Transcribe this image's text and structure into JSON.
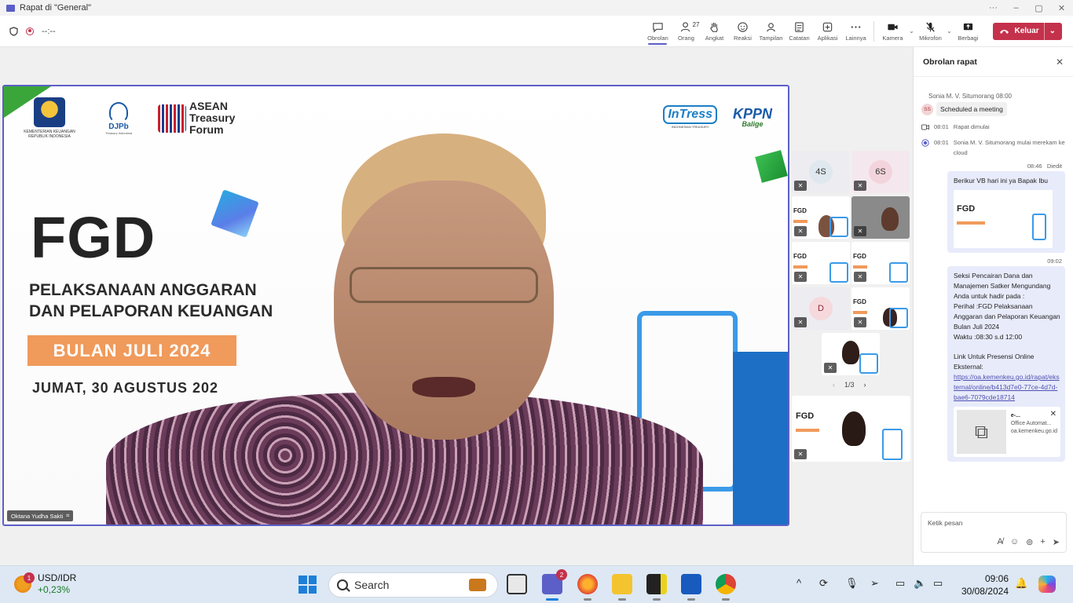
{
  "window": {
    "title": "Rapat di \"General\"",
    "min": "–",
    "max": "▢",
    "close": "✕",
    "more": "···"
  },
  "recording": {
    "timer": "--:--"
  },
  "toolbar": {
    "items": [
      {
        "label": "Obrolan",
        "icon": "chat-icon"
      },
      {
        "label": "Orang",
        "icon": "people-icon",
        "count": "27"
      },
      {
        "label": "Angkat",
        "icon": "raise-hand-icon"
      },
      {
        "label": "Reaksi",
        "icon": "reaction-icon"
      },
      {
        "label": "Tampilan",
        "icon": "view-icon"
      },
      {
        "label": "Catatan",
        "icon": "notes-icon"
      },
      {
        "label": "Aplikasi",
        "icon": "apps-icon"
      },
      {
        "label": "Lainnya",
        "icon": "more-icon"
      },
      {
        "label": "Kamera",
        "icon": "camera-icon"
      },
      {
        "label": "Mikrofon",
        "icon": "mic-off-icon"
      },
      {
        "label": "Berbagi",
        "icon": "share-icon"
      }
    ],
    "leave_label": "Keluar"
  },
  "slide": {
    "org1": "KEMENTERIAN KEUANGAN",
    "org1_sub": "REPUBLIK INDONESIA",
    "org2": "DJPb",
    "org2_sub": "Treasury Indonesia",
    "org3_line1": "ASEAN",
    "org3_line2": "Treasury",
    "org3_line3": "Forum",
    "org4": "InTress",
    "org4_sub": "INDONESIAN TREASURY",
    "org5": "KPPN",
    "org5_sub": "Balige",
    "title": "FGD",
    "subtitle_line1": "PELAKSANAAN ANGGARAN",
    "subtitle_line2": "DAN PELAPORAN KEUANGAN",
    "month_badge": "BULAN JULI 2024",
    "date": "JUMAT, 30 AGUSTUS 202"
  },
  "speaker": {
    "name": "Oktana Yudha Sakti"
  },
  "participants": {
    "tiles": [
      {
        "initials": "4S"
      },
      {
        "initials": "6S"
      },
      {
        "initials": "D"
      }
    ],
    "pager": {
      "prev": "‹",
      "label": "1/3",
      "next": "›"
    },
    "mini_title": "FGD"
  },
  "chat": {
    "title": "Obrolan rapat",
    "system": {
      "sender": "Sonia M. V. Situmorang",
      "time": "08:00",
      "avatar": "SS",
      "message": "Scheduled a meeting"
    },
    "events": [
      {
        "time": "08:01",
        "text": "Rapat dimulai",
        "icon": "meeting-icon"
      },
      {
        "time": "08:01",
        "text": "Sonia M. V. Situmorang mulai merekam ke cloud",
        "icon": "record-icon"
      }
    ],
    "msg1": {
      "stamp": "08:46",
      "edited": "Diedit",
      "text": "Berikur VB hari ini ya Bapak Ibu"
    },
    "msg2": {
      "stamp": "09:02",
      "lines": [
        "Seksi Pencairan Dana dan Manajemen Satker Mengundang Anda untuk hadir pada :",
        "Perihal :FGD Pelaksanaan Anggaran dan Pelaporan Keuangan Bulan Juli 2024",
        "Waktu :08:30 s.d 12:00"
      ],
      "link_label": "Link Untuk Presensi Online Eksternal:",
      "link": "https://oa.kemenkeu.go.id/rapat/eksternal/online/b413d7e0-77ce-4d7d-bae6-7079cde18714",
      "card_title": "e-...",
      "card_desc": "Office Automat...",
      "card_domain": "oa.kemenkeu.go.id"
    },
    "input_placeholder": "Ketik pesan"
  },
  "taskbar": {
    "widget_badge": "1",
    "widget_label": "USD/IDR",
    "widget_change": "+0,23%",
    "search_label": "Search",
    "teams_badge": "2",
    "time": "09:06",
    "date": "30/08/2024"
  }
}
